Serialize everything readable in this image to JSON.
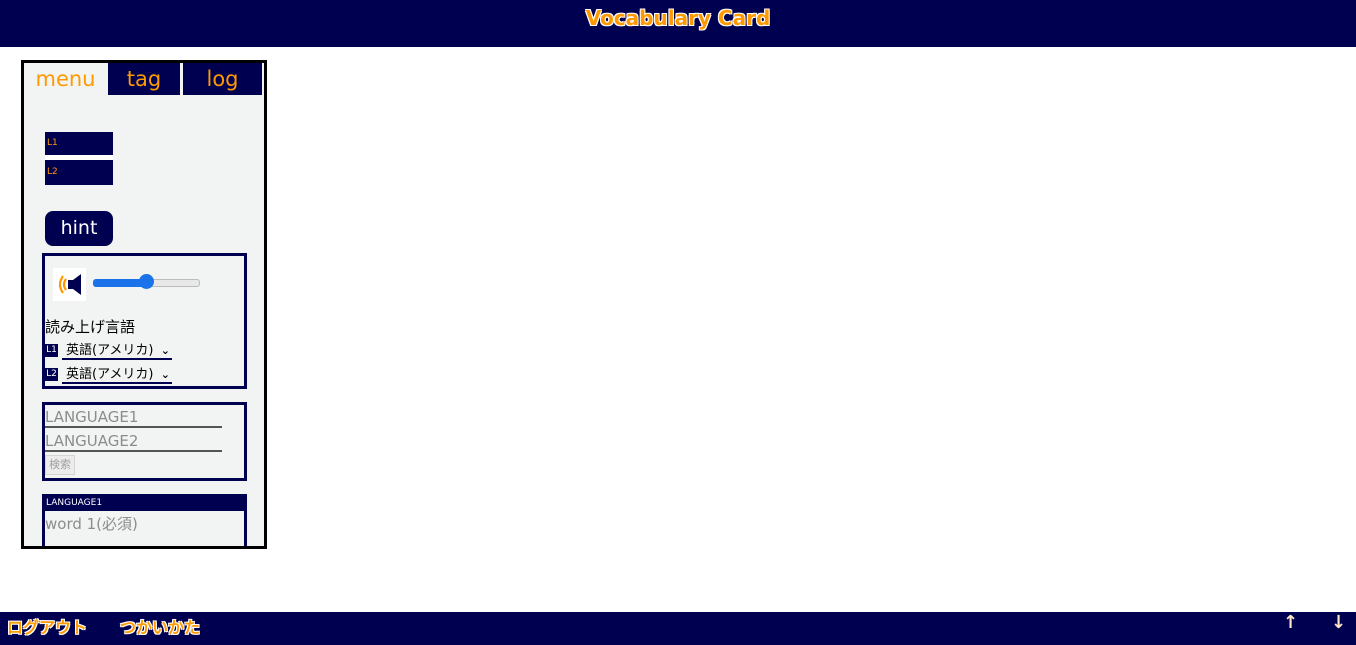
{
  "app": {
    "title": "Vocabulary Card"
  },
  "tabs": [
    {
      "label": "menu",
      "active": true
    },
    {
      "label": "tag",
      "active": false
    },
    {
      "label": "log",
      "active": false
    }
  ],
  "lang_card": {
    "top_label": "L1",
    "bottom_label": "L2"
  },
  "hint_button": {
    "label": "hint"
  },
  "voice": {
    "icon": "speaker-icon",
    "volume": 0.5,
    "label": "読み上げ言語",
    "selects": [
      {
        "badge": "L1",
        "value": "英語(アメリカ)"
      },
      {
        "badge": "L2",
        "value": "英語(アメリカ)"
      }
    ]
  },
  "search": {
    "field1_placeholder": "LANGUAGE1",
    "field2_placeholder": "LANGUAGE2",
    "button_label": "検索"
  },
  "word_entry": {
    "header": "LANGUAGE1",
    "placeholder": "word 1(必須)"
  },
  "footer": {
    "logout": "ログアウト",
    "howto": "つかいかた",
    "up_arrow": "↑",
    "down_arrow": "↓"
  },
  "colors": {
    "navy": "#000050",
    "accent": "#ff9900",
    "panel_bg": "#f2f4f4",
    "slider": "#1a73e8"
  }
}
